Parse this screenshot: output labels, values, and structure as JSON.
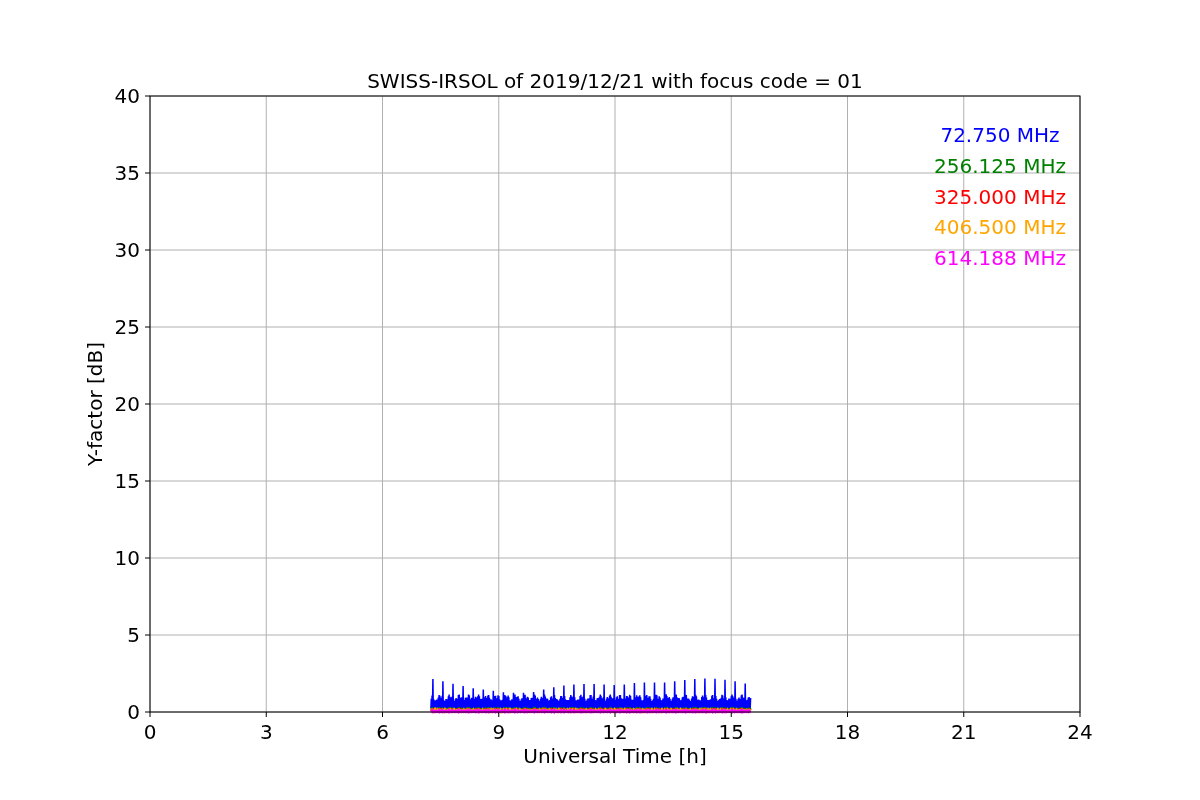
{
  "chart_data": {
    "type": "line",
    "title": "SWISS-IRSOL of 2019/12/21 with focus code = 01",
    "xlabel": "Universal Time [h]",
    "ylabel": "Y-factor [dB]",
    "xlim": [
      0,
      24
    ],
    "ylim": [
      0,
      40
    ],
    "xticks": [
      0,
      3,
      6,
      9,
      12,
      15,
      18,
      21,
      24
    ],
    "yticks": [
      0,
      5,
      10,
      15,
      20,
      25,
      30,
      35,
      40
    ],
    "grid": true
  },
  "legend": [
    {
      "label": "72.750 MHz",
      "color": "#0000ff"
    },
    {
      "label": "256.125 MHz",
      "color": "#008000"
    },
    {
      "label": "325.000 MHz",
      "color": "#ff0000"
    },
    {
      "label": "406.500 MHz",
      "color": "#ffa500"
    },
    {
      "label": "614.188 MHz",
      "color": "#ff00ff"
    }
  ]
}
